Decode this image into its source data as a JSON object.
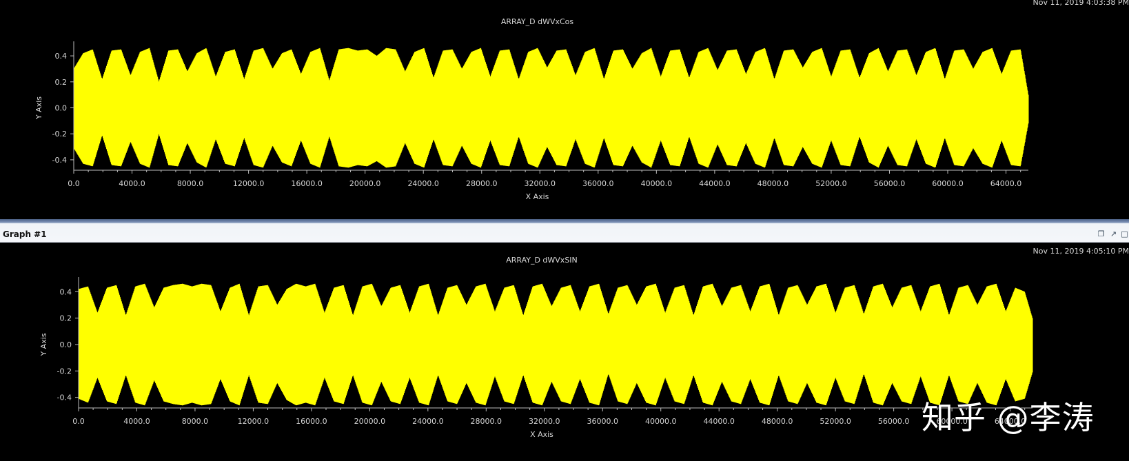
{
  "graph_panel": {
    "tab_label": "Graph #1",
    "window_buttons": [
      "restore-icon",
      "maximize-icon",
      "close-icon"
    ]
  },
  "watermark_text": "知乎 @李涛",
  "colors": {
    "signal": "#ffff00",
    "background": "#000000",
    "axis": "#bdbdbd",
    "text": "#d8d8d8"
  },
  "chart_data": [
    {
      "type": "line",
      "title": "ARRAY_D dWVxCos",
      "timestamp": "Nov 11, 2019 4:03:38 PM",
      "xlabel": "X Axis",
      "ylabel": "Y Axis",
      "xlim": [
        0,
        65536
      ],
      "ylim": [
        -0.48,
        0.48
      ],
      "xticks": [
        "0.0",
        "4000.0",
        "8000.0",
        "12000.0",
        "16000.0",
        "20000.0",
        "24000.0",
        "28000.0",
        "32000.0",
        "36000.0",
        "40000.0",
        "44000.0",
        "48000.0",
        "52000.0",
        "56000.0",
        "60000.0",
        "64000.0"
      ],
      "yticks": [
        "0.4",
        "0.2",
        "0.0",
        "-0.2",
        "-0.4"
      ],
      "grid": false,
      "series": [
        {
          "color": "#ffff00",
          "envelope_x": [
            0,
            650,
            1300,
            1950,
            2600,
            3250,
            3900,
            4550,
            5200,
            5850,
            6500,
            7150,
            7800,
            8450,
            9100,
            9750,
            10400,
            11050,
            11700,
            12350,
            13000,
            13650,
            14300,
            14950,
            15600,
            16250,
            16900,
            17550,
            18200,
            18850,
            19500,
            20150,
            20800,
            21450,
            22100,
            22750,
            23400,
            24050,
            24700,
            25350,
            26000,
            26650,
            27300,
            27950,
            28600,
            29250,
            29900,
            30550,
            31200,
            31850,
            32500,
            33150,
            33800,
            34450,
            35100,
            35750,
            36400,
            37050,
            37700,
            38350,
            39000,
            39650,
            40300,
            40950,
            41600,
            42250,
            42900,
            43550,
            44200,
            44850,
            45500,
            46150,
            46800,
            47450,
            48100,
            48750,
            49400,
            50050,
            50700,
            51350,
            52000,
            52650,
            53300,
            53950,
            54600,
            55250,
            55900,
            56550,
            57200,
            57850,
            58500,
            59150,
            59800,
            60450,
            61100,
            61750,
            62400,
            63050,
            63700,
            64350,
            65000,
            65536
          ],
          "envelope_max": [
            0.3,
            0.42,
            0.45,
            0.22,
            0.44,
            0.45,
            0.25,
            0.43,
            0.46,
            0.2,
            0.44,
            0.45,
            0.28,
            0.42,
            0.46,
            0.24,
            0.43,
            0.45,
            0.22,
            0.44,
            0.46,
            0.3,
            0.42,
            0.45,
            0.26,
            0.43,
            0.46,
            0.21,
            0.45,
            0.46,
            0.44,
            0.45,
            0.4,
            0.46,
            0.45,
            0.28,
            0.43,
            0.46,
            0.23,
            0.44,
            0.45,
            0.3,
            0.43,
            0.46,
            0.24,
            0.44,
            0.45,
            0.22,
            0.43,
            0.46,
            0.31,
            0.44,
            0.45,
            0.25,
            0.43,
            0.46,
            0.22,
            0.44,
            0.45,
            0.3,
            0.42,
            0.46,
            0.24,
            0.44,
            0.45,
            0.23,
            0.43,
            0.46,
            0.29,
            0.44,
            0.45,
            0.26,
            0.43,
            0.46,
            0.22,
            0.44,
            0.45,
            0.31,
            0.43,
            0.46,
            0.24,
            0.44,
            0.45,
            0.23,
            0.42,
            0.46,
            0.28,
            0.44,
            0.45,
            0.25,
            0.43,
            0.46,
            0.22,
            0.44,
            0.45,
            0.3,
            0.43,
            0.46,
            0.26,
            0.44,
            0.45,
            0.1
          ],
          "envelope_min": [
            -0.31,
            -0.43,
            -0.45,
            -0.21,
            -0.44,
            -0.45,
            -0.26,
            -0.43,
            -0.46,
            -0.2,
            -0.44,
            -0.45,
            -0.27,
            -0.42,
            -0.46,
            -0.24,
            -0.43,
            -0.45,
            -0.23,
            -0.44,
            -0.46,
            -0.29,
            -0.42,
            -0.45,
            -0.25,
            -0.43,
            -0.46,
            -0.22,
            -0.45,
            -0.46,
            -0.44,
            -0.45,
            -0.41,
            -0.46,
            -0.45,
            -0.27,
            -0.43,
            -0.46,
            -0.24,
            -0.44,
            -0.45,
            -0.29,
            -0.43,
            -0.46,
            -0.25,
            -0.44,
            -0.45,
            -0.22,
            -0.43,
            -0.46,
            -0.3,
            -0.44,
            -0.45,
            -0.24,
            -0.43,
            -0.46,
            -0.23,
            -0.44,
            -0.45,
            -0.29,
            -0.42,
            -0.46,
            -0.25,
            -0.44,
            -0.45,
            -0.22,
            -0.43,
            -0.46,
            -0.28,
            -0.44,
            -0.45,
            -0.27,
            -0.43,
            -0.46,
            -0.23,
            -0.44,
            -0.45,
            -0.3,
            -0.43,
            -0.46,
            -0.25,
            -0.44,
            -0.45,
            -0.22,
            -0.42,
            -0.46,
            -0.29,
            -0.44,
            -0.45,
            -0.24,
            -0.43,
            -0.46,
            -0.23,
            -0.44,
            -0.45,
            -0.31,
            -0.43,
            -0.46,
            -0.25,
            -0.44,
            -0.45,
            -0.12
          ]
        }
      ]
    },
    {
      "type": "line",
      "title": "ARRAY_D dWVxSIN",
      "timestamp": "Nov 11, 2019 4:05:10 PM",
      "xlabel": "X Axis",
      "ylabel": "Y Axis",
      "xlim": [
        0,
        65536
      ],
      "ylim": [
        -0.48,
        0.48
      ],
      "xticks": [
        "0.0",
        "4000.0",
        "8000.0",
        "12000.0",
        "16000.0",
        "20000.0",
        "24000.0",
        "28000.0",
        "32000.0",
        "36000.0",
        "40000.0",
        "44000.0",
        "48000.0",
        "52000.0",
        "56000.0",
        "60000.0",
        "64000.0"
      ],
      "yticks": [
        "0.4",
        "0.2",
        "0.0",
        "-0.2",
        "-0.4"
      ],
      "grid": false,
      "series": [
        {
          "color": "#ffff00",
          "envelope_x": [
            0,
            650,
            1300,
            1950,
            2600,
            3250,
            3900,
            4550,
            5200,
            5850,
            6500,
            7150,
            7800,
            8450,
            9100,
            9750,
            10400,
            11050,
            11700,
            12350,
            13000,
            13650,
            14300,
            14950,
            15600,
            16250,
            16900,
            17550,
            18200,
            18850,
            19500,
            20150,
            20800,
            21450,
            22100,
            22750,
            23400,
            24050,
            24700,
            25350,
            26000,
            26650,
            27300,
            27950,
            28600,
            29250,
            29900,
            30550,
            31200,
            31850,
            32500,
            33150,
            33800,
            34450,
            35100,
            35750,
            36400,
            37050,
            37700,
            38350,
            39000,
            39650,
            40300,
            40950,
            41600,
            42250,
            42900,
            43550,
            44200,
            44850,
            45500,
            46150,
            46800,
            47450,
            48100,
            48750,
            49400,
            50050,
            50700,
            51350,
            52000,
            52650,
            53300,
            53950,
            54600,
            55250,
            55900,
            56550,
            57200,
            57850,
            58500,
            59150,
            59800,
            60450,
            61100,
            61750,
            62400,
            63050,
            63700,
            64350,
            65000,
            65536
          ],
          "envelope_max": [
            0.42,
            0.44,
            0.24,
            0.43,
            0.45,
            0.22,
            0.44,
            0.46,
            0.28,
            0.43,
            0.45,
            0.46,
            0.44,
            0.46,
            0.45,
            0.25,
            0.43,
            0.46,
            0.22,
            0.44,
            0.45,
            0.3,
            0.42,
            0.46,
            0.44,
            0.46,
            0.24,
            0.43,
            0.45,
            0.22,
            0.44,
            0.46,
            0.29,
            0.43,
            0.45,
            0.24,
            0.44,
            0.46,
            0.22,
            0.43,
            0.45,
            0.3,
            0.44,
            0.46,
            0.25,
            0.43,
            0.45,
            0.22,
            0.44,
            0.46,
            0.29,
            0.43,
            0.45,
            0.25,
            0.44,
            0.46,
            0.23,
            0.43,
            0.45,
            0.3,
            0.44,
            0.46,
            0.24,
            0.43,
            0.45,
            0.22,
            0.44,
            0.46,
            0.29,
            0.43,
            0.45,
            0.25,
            0.44,
            0.46,
            0.22,
            0.43,
            0.45,
            0.3,
            0.44,
            0.46,
            0.24,
            0.43,
            0.45,
            0.23,
            0.44,
            0.46,
            0.28,
            0.43,
            0.45,
            0.25,
            0.44,
            0.46,
            0.22,
            0.43,
            0.45,
            0.3,
            0.44,
            0.46,
            0.25,
            0.43,
            0.4,
            0.2
          ],
          "envelope_min": [
            -0.41,
            -0.44,
            -0.25,
            -0.43,
            -0.45,
            -0.23,
            -0.44,
            -0.46,
            -0.27,
            -0.43,
            -0.45,
            -0.46,
            -0.44,
            -0.46,
            -0.45,
            -0.26,
            -0.43,
            -0.46,
            -0.23,
            -0.44,
            -0.45,
            -0.29,
            -0.42,
            -0.46,
            -0.44,
            -0.46,
            -0.25,
            -0.43,
            -0.45,
            -0.23,
            -0.44,
            -0.46,
            -0.28,
            -0.43,
            -0.45,
            -0.25,
            -0.44,
            -0.46,
            -0.23,
            -0.43,
            -0.45,
            -0.29,
            -0.44,
            -0.46,
            -0.24,
            -0.43,
            -0.45,
            -0.23,
            -0.44,
            -0.46,
            -0.28,
            -0.43,
            -0.45,
            -0.26,
            -0.44,
            -0.46,
            -0.22,
            -0.43,
            -0.45,
            -0.29,
            -0.44,
            -0.46,
            -0.25,
            -0.43,
            -0.45,
            -0.23,
            -0.44,
            -0.46,
            -0.28,
            -0.43,
            -0.45,
            -0.26,
            -0.44,
            -0.46,
            -0.23,
            -0.43,
            -0.45,
            -0.29,
            -0.44,
            -0.46,
            -0.25,
            -0.43,
            -0.45,
            -0.22,
            -0.44,
            -0.46,
            -0.29,
            -0.43,
            -0.45,
            -0.24,
            -0.44,
            -0.46,
            -0.23,
            -0.43,
            -0.45,
            -0.29,
            -0.44,
            -0.46,
            -0.26,
            -0.43,
            -0.41,
            -0.21
          ]
        }
      ]
    }
  ]
}
